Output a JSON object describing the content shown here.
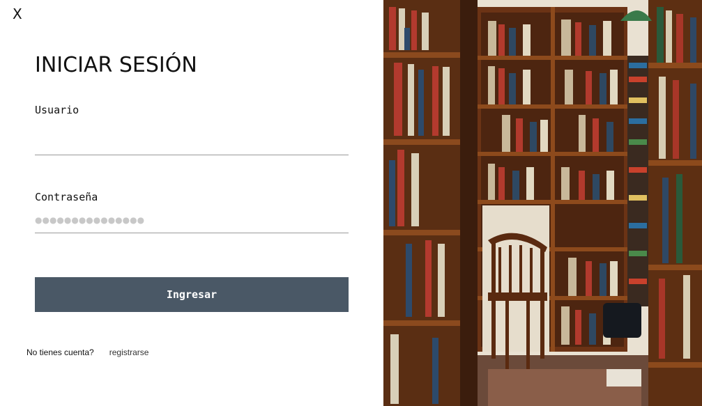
{
  "modal": {
    "close_label": "X",
    "title": "INICIAR SESIÓN"
  },
  "form": {
    "username_label": "Usuario",
    "username_value": "",
    "password_label": "Contraseña",
    "password_masked": "●●●●●●●●●●●●●●●",
    "submit_label": "Ingresar"
  },
  "footer": {
    "prompt": "No tienes cuenta?",
    "signup_link": "registrarse"
  },
  "colors": {
    "button_bg": "#4a5866",
    "button_text": "#ffffff",
    "input_underline": "#9a9a9a"
  },
  "image": {
    "subject": "bookstore shelves with a wooden chair"
  }
}
